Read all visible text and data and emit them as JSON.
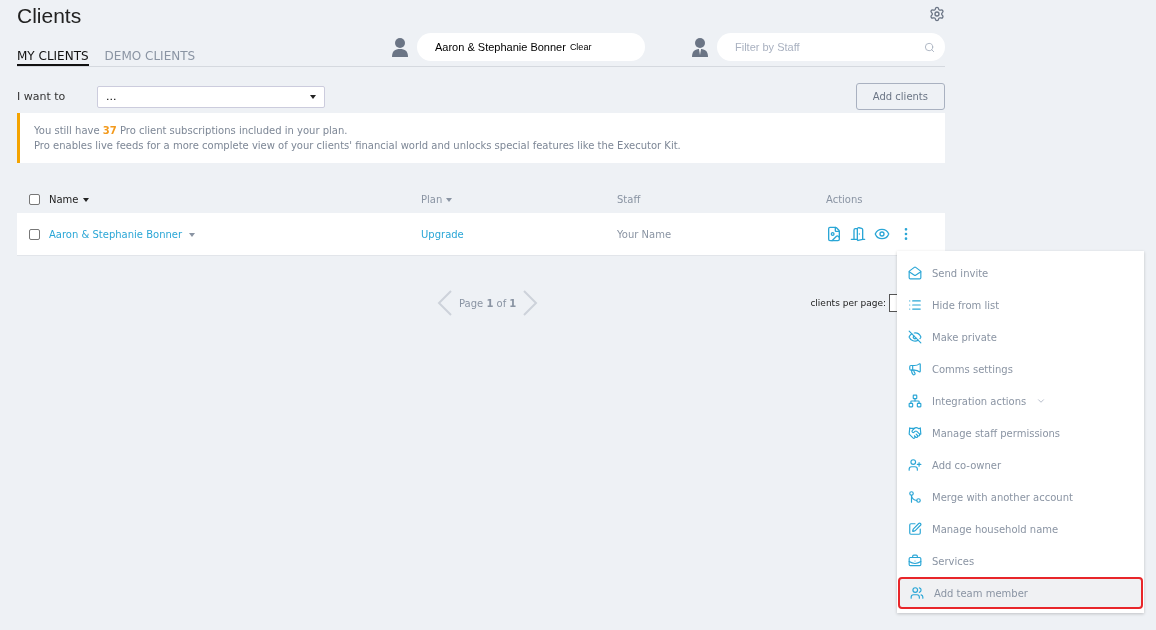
{
  "title": "Clients",
  "tabs": [
    {
      "label": "MY CLIENTS",
      "selected": true
    },
    {
      "label": "DEMO CLIENTS",
      "selected": false
    }
  ],
  "client_search": {
    "value": "Aaron & Stephanie Bonner",
    "clear": "Clear"
  },
  "staff_filter": {
    "placeholder": "Filter by Staff"
  },
  "i_want_to": {
    "label": "I want to",
    "value": "..."
  },
  "add_clients": "Add clients",
  "notice": {
    "line_1": "You still have **37** Pro client subscriptions included in your plan.",
    "line_2": "Pro enables live feeds for a more complete view of your clients' financial world and unlocks special features like the Executor Kit."
  },
  "table": {
    "select_all_checked": false,
    "columns": [
      {
        "label": "Name",
        "sortable": true
      },
      {
        "label": "Plan",
        "sortable": true
      },
      {
        "label": "Staff",
        "sortable": false
      },
      {
        "label": "Actions",
        "sortable": false
      }
    ],
    "rows": [
      {
        "checked": false,
        "name": "Aaron & Stephanie Bonner",
        "plan": "Upgrade",
        "staff": "Your Name"
      }
    ]
  },
  "pagination": {
    "label": "Page **1** of **1**",
    "per_page_label": "clients per page:"
  },
  "menu": [
    {
      "label": "Send invite",
      "kind": "item",
      "selected": false
    },
    {
      "label": "Hide from list",
      "kind": "item",
      "selected": false
    },
    {
      "label": "Make private",
      "kind": "item",
      "selected": false
    },
    {
      "label": "Comms settings",
      "kind": "item",
      "selected": false
    },
    {
      "label": "Integration actions",
      "kind": "submenu",
      "selected": false
    },
    {
      "label": "Manage staff permissions",
      "kind": "item",
      "selected": false
    },
    {
      "label": "Add co-owner",
      "kind": "item",
      "selected": false
    },
    {
      "label": "Merge with another account",
      "kind": "item",
      "selected": false
    },
    {
      "label": "Manage household name",
      "kind": "item",
      "selected": false
    },
    {
      "label": "Services",
      "kind": "item",
      "selected": false
    },
    {
      "label": "Add team member",
      "kind": "item",
      "selected": true
    }
  ]
}
